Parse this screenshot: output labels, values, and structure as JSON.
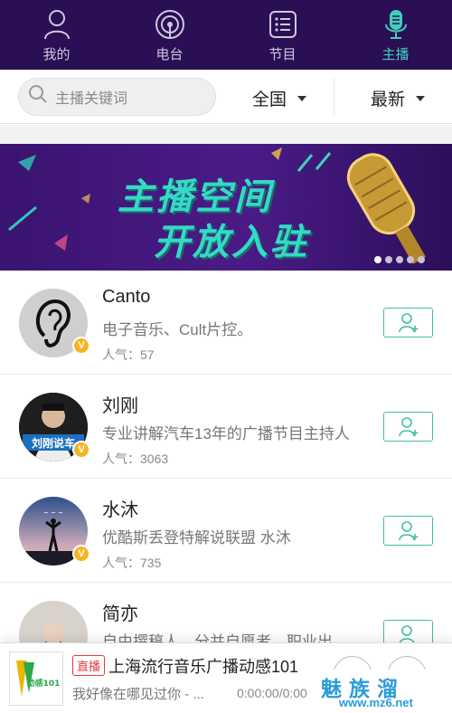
{
  "nav": {
    "tabs": [
      {
        "label": "我的",
        "icon": "person-icon",
        "active": false
      },
      {
        "label": "电台",
        "icon": "broadcast-icon",
        "active": false
      },
      {
        "label": "节目",
        "icon": "list-icon",
        "active": false
      },
      {
        "label": "主播",
        "icon": "microphone-icon",
        "active": true
      }
    ],
    "active_color": "#3fd0b9",
    "bg_color": "#2a0f55"
  },
  "filter": {
    "search_placeholder": "主播关键词",
    "region": "全国",
    "sort": "最新"
  },
  "banner": {
    "line1": "主播空间",
    "line2": "开放入驻",
    "slides": 5,
    "active_slide": 1
  },
  "anchors": [
    {
      "name": "Canto",
      "desc": "电子音乐、Cult片控。",
      "popularity": "人气：57",
      "verified_badge": "V"
    },
    {
      "name": "刘刚",
      "desc": "专业讲解汽车13年的广播节目主持人",
      "popularity": "人气：3063",
      "verified_badge": "V",
      "avatar_text": "刘刚说车"
    },
    {
      "name": "水沐",
      "desc": "优酷斯丢登特解说联盟 水沐",
      "popularity": "人气：735",
      "verified_badge": "V"
    },
    {
      "name": "简亦",
      "desc": "自由撰稿人，分并自愿者，职业出",
      "popularity": "",
      "verified_badge": ""
    }
  ],
  "player": {
    "live_tag": "直播",
    "title": "上海流行音乐广播动感101",
    "subtitle": "我好像在哪见过你 - ...",
    "time": "0:00:00/0:00:00",
    "cover_text": "动感101"
  },
  "watermark": {
    "line1": "魅族溜",
    "line2": "www.mz6.net"
  }
}
